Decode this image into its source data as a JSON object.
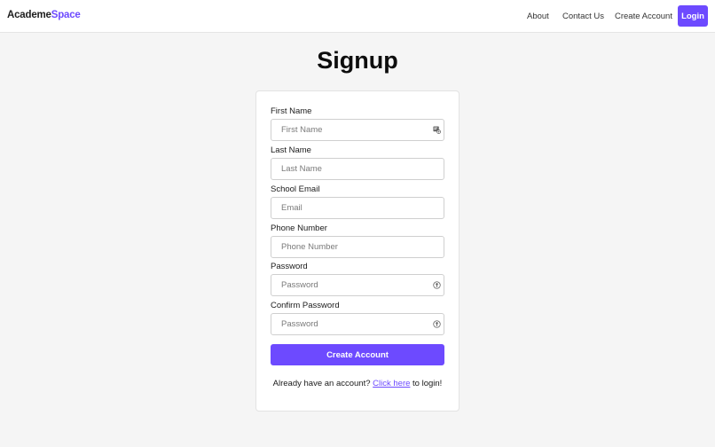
{
  "nav": {
    "brand_part1": "Academe",
    "brand_part2": "Space",
    "links": [
      "About",
      "Contact Us",
      "Create Account"
    ],
    "login_label": "Login"
  },
  "page": {
    "title": "Signup"
  },
  "form": {
    "fields": [
      {
        "label": "First Name",
        "placeholder": "First Name",
        "icon": "contact-card-icon"
      },
      {
        "label": "Last Name",
        "placeholder": "Last Name"
      },
      {
        "label": "School Email",
        "placeholder": "Email"
      },
      {
        "label": "Phone Number",
        "placeholder": "Phone Number"
      },
      {
        "label": "Password",
        "placeholder": "Password",
        "icon": "key-icon"
      },
      {
        "label": "Confirm Password",
        "placeholder": "Password",
        "icon": "key-icon"
      }
    ],
    "submit_label": "Create Account",
    "login_prompt_before": "Already have an account? ",
    "login_link": "Click here",
    "login_prompt_after": " to login!"
  },
  "colors": {
    "accent": "#6d4aff",
    "background": "#f5f5f5",
    "card": "#ffffff"
  }
}
